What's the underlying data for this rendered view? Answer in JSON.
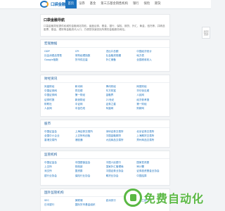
{
  "header": {
    "logo_text": "口袋金融",
    "nav": [
      "首页",
      "证券",
      "基金",
      "第三方基金销售机构",
      "银行",
      "保险",
      "期货"
    ]
  },
  "intro": {
    "title": "口袋金融导航",
    "text": "口袋金融导航提供权威的金融网站导航，涵盖证券、基金、银行、保险、期货、外汇、黄金、信托等，并精选股票、基金、理财等金融资讯入口，方便您快速查找所需的金融服务网站。"
  },
  "sections": [
    {
      "title": "宏观数据",
      "links": [
        "GDP",
        "CPI",
        "进出口总额",
        "中国经济统计",
        "社会消费品零售",
        "采购经理指数",
        "社会融资规模",
        "地方债",
        "Google指数",
        "货币供应量",
        "外汇储备",
        "全国税收收入"
      ]
    },
    {
      "title": "财经资讯",
      "links": [
        "凤凰财经",
        "和讯网",
        "腾讯财经",
        "网易财经",
        "中国证券网",
        "同花顺",
        "东方财富",
        "华尔街见闻",
        "中国证券网",
        "第一财经",
        "金融界",
        "人民网",
        "证券时报",
        "新浪财经",
        "21世纪",
        "经济参考报",
        "财联社",
        "中证网",
        "证券之星",
        "第一财经",
        "人民网",
        "中金在线",
        "凤凰网",
        "财新网"
      ]
    },
    {
      "title": "股市",
      "links": [
        "中国证监会",
        "上海证券交易所",
        "深圳证券交易所",
        "北京证券交易所",
        "全国中小企业",
        "上交所科创板",
        "中国金融期货",
        "上海期货交易所",
        "香港交易所",
        "港股通",
        "大连商品交易所",
        "郑州商品交易所"
      ]
    },
    {
      "title": "监管机构",
      "links": [
        "中国证监会",
        "中国银保监会",
        "中国人民银行",
        "国家发改委",
        "上交所",
        "财政部",
        "国家外汇管理局",
        "审计署",
        "深交所",
        "国资委",
        "中国证券业协会",
        "证券投资基金业协会",
        "银行业协会",
        "保险行业协会",
        "期货业协会",
        "中国结算"
      ]
    },
    {
      "title": "国外监管机构",
      "links": [
        "SEC",
        "美联储",
        "欧洲央行",
        "英格兰银行",
        "日本银行",
        "国际货币基金组织"
      ]
    }
  ],
  "side": {
    "label_top": "返回",
    "label_bottom": "顶部"
  },
  "watermark": {
    "text": "免费自动化"
  }
}
